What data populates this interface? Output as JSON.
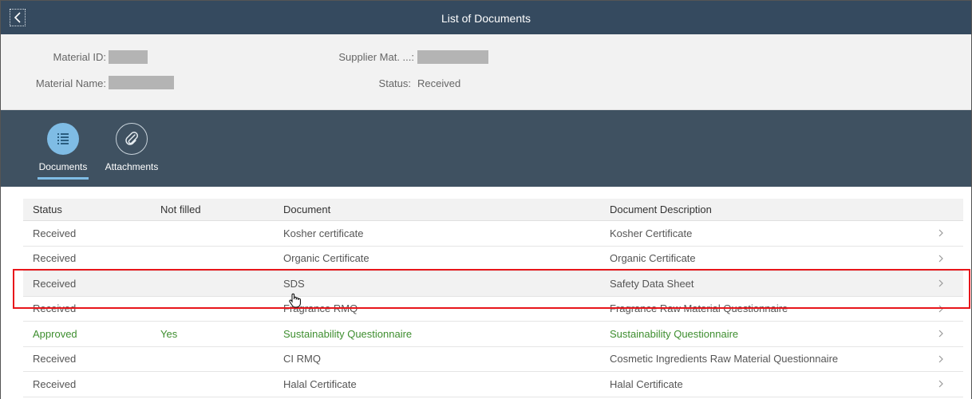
{
  "shell": {
    "title": "List of Documents",
    "back_icon": "chevron-left-icon"
  },
  "header": {
    "material_id_label": "Material ID:",
    "material_name_label": "Material Name:",
    "supplier_mat_label": "Supplier Mat. ...:",
    "status_label": "Status:",
    "status_value": "Received"
  },
  "tabs": [
    {
      "label": "Documents",
      "icon": "list-icon",
      "active": true
    },
    {
      "label": "Attachments",
      "icon": "paperclip-icon",
      "active": false
    }
  ],
  "table": {
    "columns": [
      "Status",
      "Not filled",
      "Document",
      "Document Description"
    ],
    "rows": [
      {
        "status": "Received",
        "not_filled": "",
        "document": "Kosher certificate",
        "description": "Kosher Certificate"
      },
      {
        "status": "Received",
        "not_filled": "",
        "document": "Organic Certificate",
        "description": "Organic Certificate"
      },
      {
        "status": "Received",
        "not_filled": "",
        "document": "SDS",
        "description": "Safety Data Sheet"
      },
      {
        "status": "Received",
        "not_filled": "",
        "document": "Fragrance RMQ",
        "description": "Fragrance Raw Material Questionnaire"
      },
      {
        "status": "Approved",
        "not_filled": "Yes",
        "document": "Sustainability Questionnaire",
        "description": "Sustainability Questionnaire"
      },
      {
        "status": "Received",
        "not_filled": "",
        "document": "CI RMQ",
        "description": "Cosmetic Ingredients Raw Material Questionnaire"
      },
      {
        "status": "Received",
        "not_filled": "",
        "document": "Halal Certificate",
        "description": "Halal Certificate"
      }
    ]
  },
  "colors": {
    "shell": "#354a5f",
    "iconbar": "#3f5161",
    "accent": "#7fbce5",
    "approved": "#3e8e2f",
    "highlight": "#e8161b"
  }
}
